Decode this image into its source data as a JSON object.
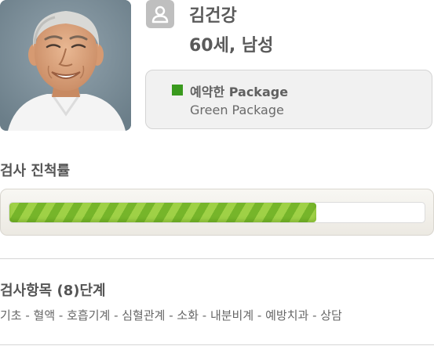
{
  "patient": {
    "name": "김건강",
    "info": "60세, 남성"
  },
  "package": {
    "label": "예약한 Package",
    "value": "Green Package",
    "color": "#3a9a1e"
  },
  "progress": {
    "title": "검사 진척률",
    "fraction": 0.74,
    "fill_color": "#8cc63a"
  },
  "exam_items": {
    "title": "검사항목 (8)단계",
    "list": "기초 - 혈액 - 호흡기계 - 심혈관계 - 소화 - 내분비계 - 예방치과 - 상담"
  },
  "icons": {
    "badge": "user-icon"
  }
}
